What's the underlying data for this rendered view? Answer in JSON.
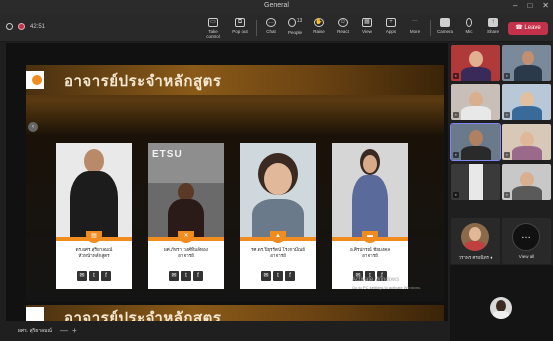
{
  "window": {
    "title": "General",
    "min": "–",
    "max": "□",
    "close": "✕"
  },
  "toolbar": {
    "timer": "42:51",
    "take_control": "Take control",
    "pop_out": "Pop out",
    "chat": "Chat",
    "people": "People",
    "people_count": "13",
    "raise": "Raise",
    "react": "React",
    "view": "View",
    "apps": "Apps",
    "more": "More",
    "camera": "Camera",
    "mic": "Mic",
    "share": "Share",
    "leave": "Leave"
  },
  "slide": {
    "title": "อาจารย์ประจำหลักสูตร",
    "cards": [
      {
        "name_line1": "ดร.ผศร.สุริยาลมณ์",
        "name_line2": "หัวหน้าหลักสูตร"
      },
      {
        "name_line1": "ผศ.ภัทรา วงศ์ทิมล์ทอง",
        "name_line2": "อาจารย์"
      },
      {
        "name_line1": "รศ.ดร.ปิยุรรัตน์ โรงกามีณย์",
        "name_line2": "อาจารย์"
      },
      {
        "name_line1": "อ.ศิรปกรณ์ ชัยมงคล",
        "name_line2": "อาจารย์"
      }
    ],
    "sign_text": "ETSU",
    "watermark_title": "Activate Windows",
    "watermark_sub": "Go to PC settings to activate Windows."
  },
  "slide_next": {
    "title": "อาจารย์ประจำหลักสูตร"
  },
  "bottom": {
    "presenter": "ผศร. สุริยาลมณ์",
    "zoom_out": "—",
    "zoom_in": "+"
  },
  "gallery": {
    "avatar_label": "วราพร ศรอนิทร",
    "view_all": "View all",
    "view_all_glyph": "…"
  },
  "colors": {
    "accent_orange": "#f08c20",
    "leave_red": "#c4314b",
    "active_outline": "#7f85f5"
  }
}
